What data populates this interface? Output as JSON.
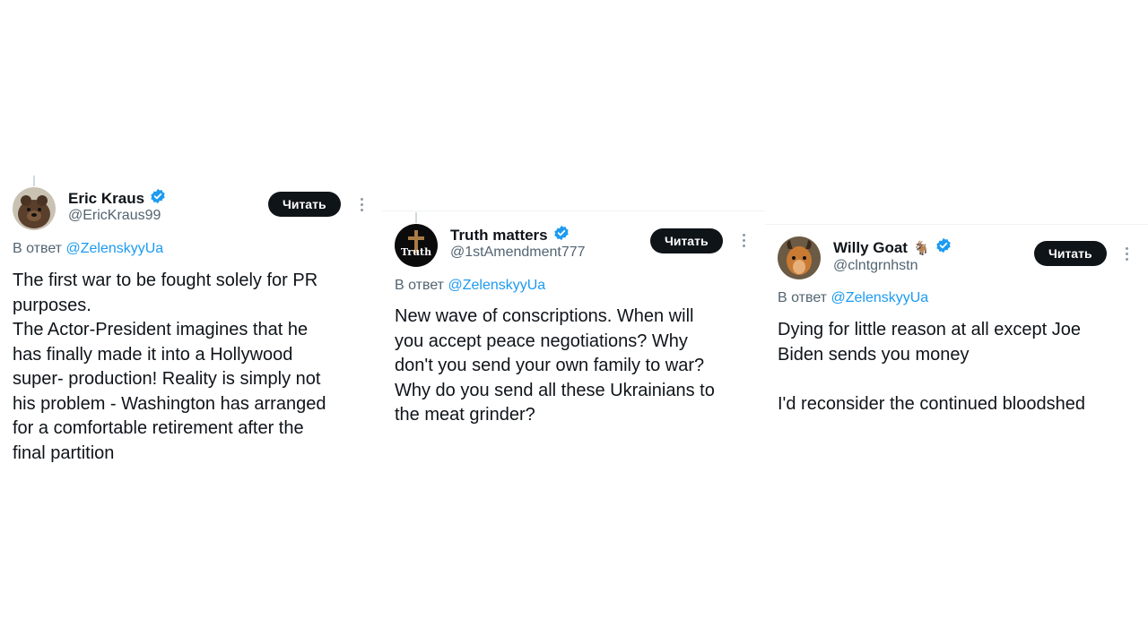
{
  "accent_color": "#1d9bf0",
  "cards": [
    {
      "name": "Eric Kraus",
      "handle": "@EricKraus99",
      "verified": true,
      "emoji": "",
      "follow_label": "Читать",
      "reply_prefix": "В ответ",
      "reply_mention": "@ZelenskyyUa",
      "body": "The first war to be fought solely for PR\npurposes.\nThe Actor-President imagines that he\nhas finally made it into a Hollywood\nsuper- production! Reality is simply not\nhis problem - Washington has arranged\nfor a comfortable retirement after the\nfinal partition"
    },
    {
      "name": "Truth matters",
      "handle": "@1stAmendment777",
      "verified": true,
      "emoji": "",
      "avatar_text": "Truth",
      "follow_label": "Читать",
      "reply_prefix": "В ответ",
      "reply_mention": "@ZelenskyyUa",
      "body": "New wave of conscriptions. When will\nyou accept peace negotiations? Why\ndon't you send your own family to war?\nWhy do you send all these Ukrainians to\nthe meat grinder?"
    },
    {
      "name": "Willy Goat",
      "handle": "@clntgrnhstn",
      "verified": true,
      "emoji": "🐐",
      "follow_label": "Читать",
      "reply_prefix": "В ответ",
      "reply_mention": "@ZelenskyyUa",
      "body": "Dying for little reason at all except Joe\nBiden sends you money\n\nI'd reconsider the continued bloodshed"
    }
  ]
}
